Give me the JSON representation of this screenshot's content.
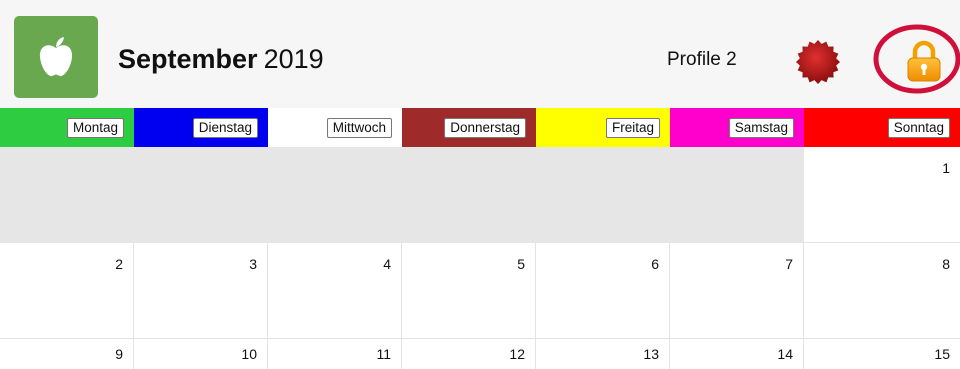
{
  "header": {
    "month": "September",
    "year": "2019",
    "profile": "Profile 2",
    "app_icon": "apple-icon",
    "badge_icon": "seal-badge-icon",
    "lock_icon": "padlock-icon"
  },
  "weekdays": [
    {
      "label": "Montag",
      "color": "#2ecc40"
    },
    {
      "label": "Dienstag",
      "color": "#0000f0"
    },
    {
      "label": "Mittwoch",
      "color": "#ffffff"
    },
    {
      "label": "Donnerstag",
      "color": "#9e2a2a"
    },
    {
      "label": "Freitag",
      "color": "#ffff00"
    },
    {
      "label": "Samstag",
      "color": "#ff00cc"
    },
    {
      "label": "Sonntag",
      "color": "#ff0000"
    }
  ],
  "weeks": [
    [
      "",
      "",
      "",
      "",
      "",
      "",
      "1"
    ],
    [
      "2",
      "3",
      "4",
      "5",
      "6",
      "7",
      "8"
    ],
    [
      "9",
      "10",
      "11",
      "12",
      "13",
      "14",
      "15"
    ]
  ],
  "colors": {
    "app_icon_bg": "#6aa84f",
    "header_bg": "#f6f6f6",
    "empty_cell": "#e6e6e6",
    "highlight_ring": "#d0103a"
  }
}
